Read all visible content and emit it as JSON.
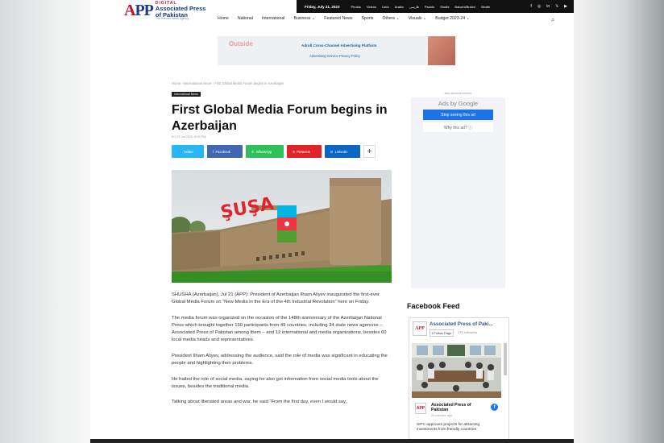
{
  "header": {
    "date": "Friday, July 21, 2023",
    "languages": [
      "Photos",
      "Videos",
      "Urdu",
      "Arabic",
      "فارسی",
      "Pashto",
      "Sindhi",
      "Balochi/Brahvi",
      "Sindhi"
    ],
    "social_icons": [
      "facebook-icon",
      "instagram-icon",
      "linkedin-icon",
      "twitter-icon",
      "youtube-icon"
    ],
    "logo": {
      "mark_a": "A",
      "mark_pp": "PP",
      "digital": "DIGITAL",
      "name_line1": "Associated Press",
      "name_line2": "of Pakistan",
      "tagline": "The Premier News Agency"
    },
    "nav": [
      "Home",
      "National",
      "International",
      "Business ⌄",
      "Featured News",
      "Sports",
      "Others ⌄",
      "Visuals ⌄",
      "Budget 2023-24 ⌄"
    ],
    "search_icon": "⌕"
  },
  "ad": {
    "brand": "Outside",
    "title": "Adroll Cross-Channel Advertising Platform",
    "links": "Advertising Service Privacy Policy"
  },
  "article": {
    "breadcrumb": "Home  ›  International News  ›  First Global Media Forum begins in Azerbaijan",
    "category": "International News",
    "title": "First Global Media Forum begins in Azerbaijan",
    "meta": "Fri, 21 Jul 2023, 8:24 PM",
    "share": {
      "twitter": "Twitter",
      "facebook": "Facebook",
      "whatsapp": "WhatsApp",
      "pinterest": "Pinterest",
      "linkedin": "LinkedIn",
      "more": "+"
    },
    "image_text": "ŞUŞA",
    "paragraphs": [
      "SHUSHA (Azerbaijan), Jul 21 (APP): President of Azerbaijan Ilham Aliyev inaugurated the first-ever Global Media Forum on “New Media in the Era of the 4th Industrial Revolution” here on Friday.",
      "The media forum was organized on the occasion of the 148th anniversary of the Azerbaijan National Press which brought together 150 participants from 49 countries, including 34 state news agencies – Associated Press of Pakistan among them – and 12 international and media organizations, besides 60 local media heads and representatives.",
      "President Ilham Aliyev, addressing the audience, said the role of media was significant in educating the people and highlighting their problems.",
      "He hailed the role of social media, saying he also got information from social media tools about the issues, besides the traditional media.",
      "Talking about liberated areas and war, he said “From the first day, even I would say,"
    ]
  },
  "sidebar": {
    "ad_label": "- Ads advertisements -",
    "ads_by": "Ads by Google",
    "stop_button": "Stop seeing this ad",
    "why_button": "Why this ad? ⓘ",
    "facebook_feed_title": "Facebook Feed",
    "fb_page_name": "Associated Press of Paki...",
    "fb_follow": "Follow Page",
    "fb_followers": "17K followers",
    "fb_post_name": "Associated Press of Pakistan",
    "fb_post_time": "20 minutes ago",
    "fb_post_text": "SIFC approves projects for attracting investments from friendly countries",
    "fb_logo": "APP"
  }
}
